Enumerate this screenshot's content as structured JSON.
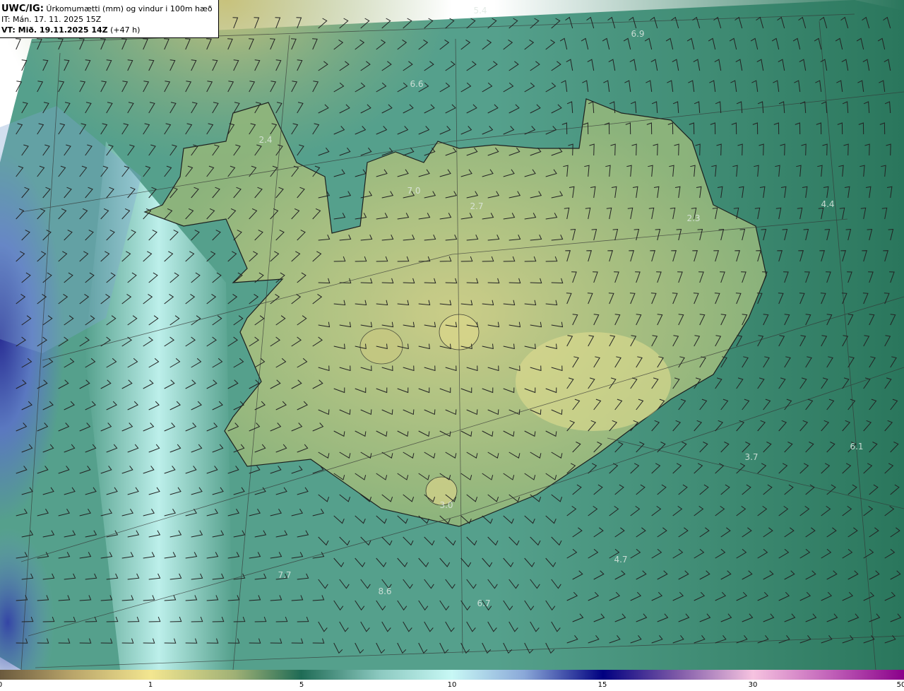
{
  "header": {
    "model": "UWC/IG:",
    "product": "Úrkomumætti (mm) og vindur i 100m hæð",
    "initial_time": "IT: Mán. 17. 11. 2025 15Z",
    "valid_prefix": "VT: Mið. 19.11.2025 14Z",
    "valid_offset": "(+47 h)"
  },
  "colorbar": {
    "ticks": [
      "0",
      "1",
      "5",
      "10",
      "15",
      "30",
      "50"
    ],
    "colors": [
      "#6b5a3e",
      "#f3e690",
      "#1f6b55",
      "#c8f8f5",
      "#000080",
      "#f6c3e0",
      "#8a008a"
    ]
  },
  "map_labels": [
    {
      "text": "5.4",
      "name": "value-label"
    },
    {
      "text": "6.9",
      "name": "value-label"
    },
    {
      "text": "6.6",
      "name": "value-label"
    },
    {
      "text": "2.4",
      "name": "value-label"
    },
    {
      "text": "7.0",
      "name": "value-label"
    },
    {
      "text": "2.7",
      "name": "value-label"
    },
    {
      "text": "2.3",
      "name": "value-label"
    },
    {
      "text": "4.4",
      "name": "value-label"
    },
    {
      "text": "3.0",
      "name": "value-label"
    },
    {
      "text": "3.7",
      "name": "value-label"
    },
    {
      "text": "6.1",
      "name": "value-label"
    },
    {
      "text": "4.7",
      "name": "value-label"
    },
    {
      "text": "7.7",
      "name": "value-label"
    },
    {
      "text": "8.6",
      "name": "value-label"
    },
    {
      "text": "6.7",
      "name": "value-label"
    }
  ]
}
